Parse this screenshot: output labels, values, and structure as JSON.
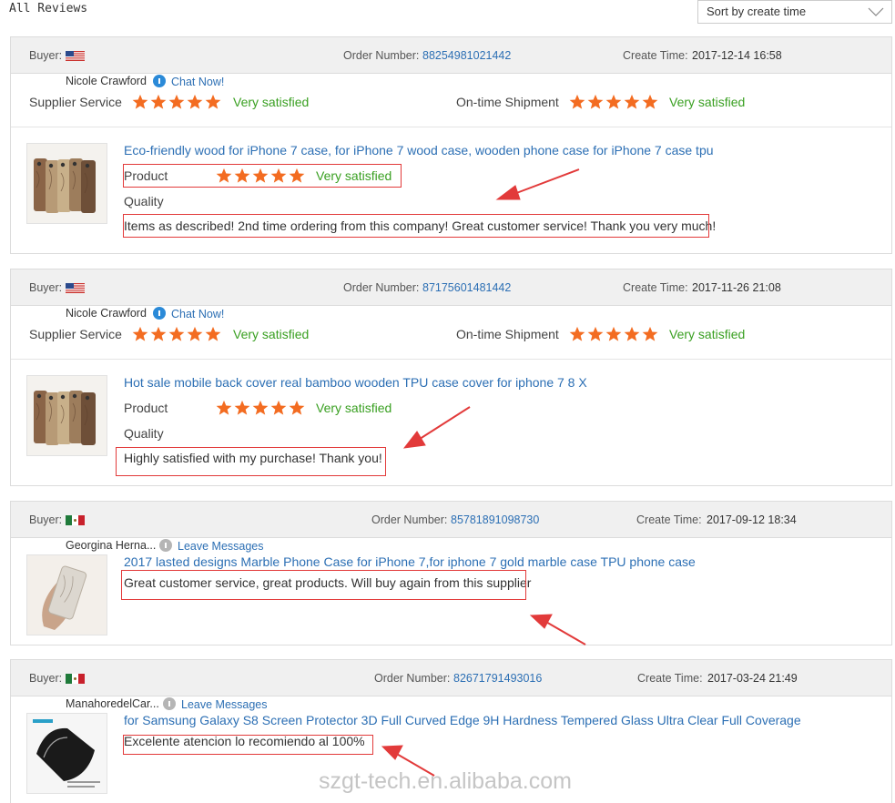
{
  "page": {
    "title": "All Reviews"
  },
  "sort": {
    "label": "Sort by create time"
  },
  "labels": {
    "buyer": "Buyer:",
    "order_number": "Order Number:",
    "create_time": "Create Time:",
    "supplier_service": "Supplier Service",
    "ontime_shipment": "On-time Shipment",
    "product": "Product",
    "quality": "Quality",
    "very_satisfied": "Very satisfied"
  },
  "reviews": [
    {
      "country": "US",
      "order_number": "88254981021442",
      "create_time": "2017-12-14 16:58",
      "buyer_name": "Nicole Crawford",
      "contact_label": "Chat Now!",
      "rating": 5,
      "product_title": "Eco-friendly wood for iPhone 7 case, for iPhone 7 wood case, wooden phone case for iPhone 7 case tpu",
      "comment": "Items as described! 2nd time ordering from this company! Great customer service! Thank you very much!"
    },
    {
      "country": "US",
      "order_number": "87175601481442",
      "create_time": "2017-11-26 21:08",
      "buyer_name": "Nicole Crawford",
      "contact_label": "Chat Now!",
      "rating": 5,
      "product_title": "Hot sale mobile back cover real bamboo wooden TPU case cover for iphone 7 8 X",
      "comment": "Highly satisfied with my purchase! Thank you!"
    },
    {
      "country": "MX",
      "order_number": "85781891098730",
      "create_time": "2017-09-12 18:34",
      "buyer_name": "Georgina Herna...",
      "contact_label": "Leave Messages",
      "product_title": "2017 lasted designs Marble Phone Case for iPhone 7,for iphone 7 gold marble case TPU phone case",
      "comment": "Great customer service, great products. Will buy again from this supplier"
    },
    {
      "country": "MX",
      "order_number": "82671791493016",
      "create_time": "2017-03-24 21:49",
      "buyer_name": "ManahoredelCar...",
      "contact_label": "Leave Messages",
      "product_title": "for Samsung Galaxy S8 Screen Protector 3D Full Curved Edge 9H Hardness Tempered Glass Ultra Clear Full Coverage",
      "comment": "Excelente atencion lo recomiendo al 100%"
    }
  ],
  "watermark": "szgt-tech.en.alibaba.com",
  "colors": {
    "link": "#2c6fb4",
    "star": "#f36c21",
    "satisfied": "#3aa022",
    "highlight": "#e23a3a"
  },
  "icons": {
    "chevron": "chevron-down-icon",
    "flag_us": "us-flag-icon",
    "flag_mx": "mexico-flag-icon",
    "chat": "chat-bubble-icon"
  }
}
